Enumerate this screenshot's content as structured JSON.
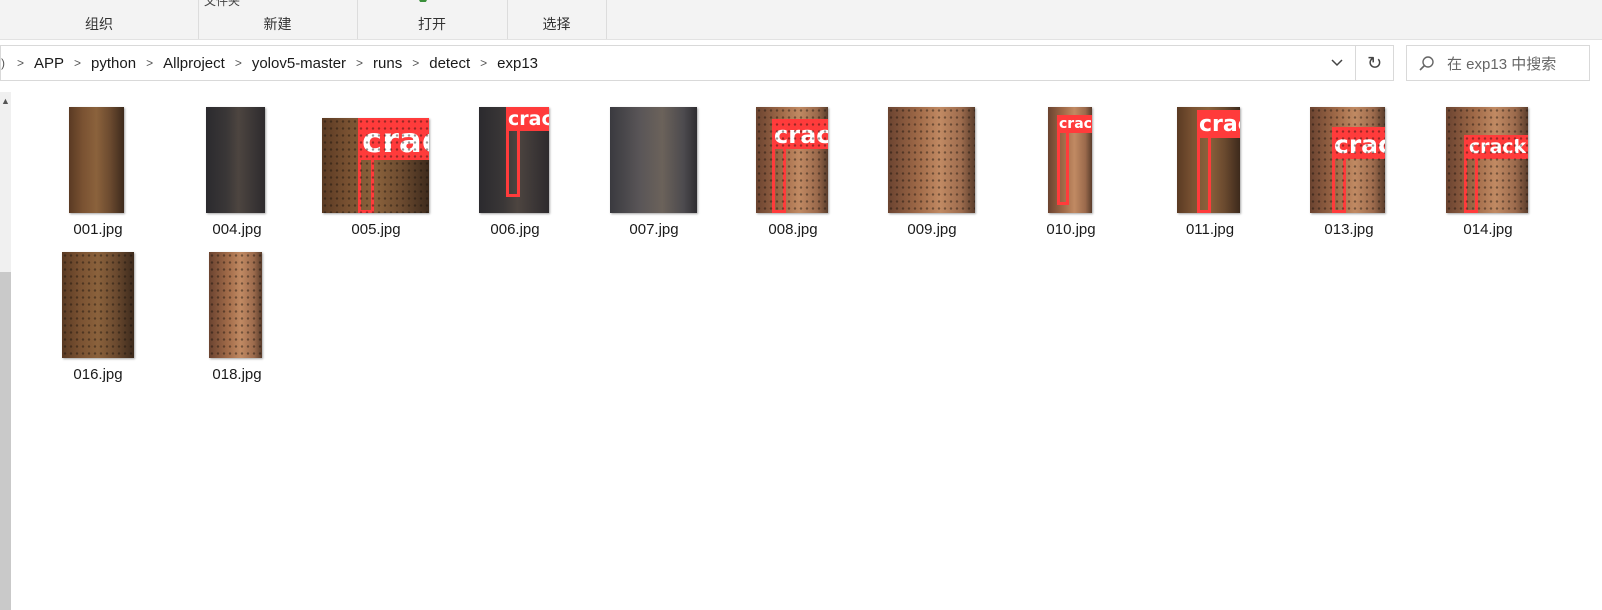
{
  "ribbon": {
    "groups": [
      {
        "label": "组织",
        "peek": ""
      },
      {
        "label": "新建",
        "peek": "文件夹"
      },
      {
        "label": "打开",
        "peek": ""
      },
      {
        "label": "选择",
        "peek": ""
      }
    ]
  },
  "address": {
    "crumbs": [
      "APP",
      "python",
      "Allproject",
      "yolov5-master",
      "runs",
      "detect",
      "exp13"
    ]
  },
  "search": {
    "placeholder": "在 exp13 中搜索"
  },
  "files": [
    {
      "name": "001.jpg",
      "label": ""
    },
    {
      "name": "004.jpg",
      "label": ""
    },
    {
      "name": "005.jpg",
      "label": "crack"
    },
    {
      "name": "006.jpg",
      "label": "crack"
    },
    {
      "name": "007.jpg",
      "label": ""
    },
    {
      "name": "008.jpg",
      "label": "crack"
    },
    {
      "name": "009.jpg",
      "label": ""
    },
    {
      "name": "010.jpg",
      "label": "crack"
    },
    {
      "name": "011.jpg",
      "label": "crack"
    },
    {
      "name": "013.jpg",
      "label": "crack"
    },
    {
      "name": "014.jpg",
      "label": "crack"
    },
    {
      "name": "016.jpg",
      "label": ""
    },
    {
      "name": "018.jpg",
      "label": ""
    }
  ],
  "colors": {
    "detection_box": "#ff3b3b",
    "ribbon_bg": "#f3f3f3"
  }
}
